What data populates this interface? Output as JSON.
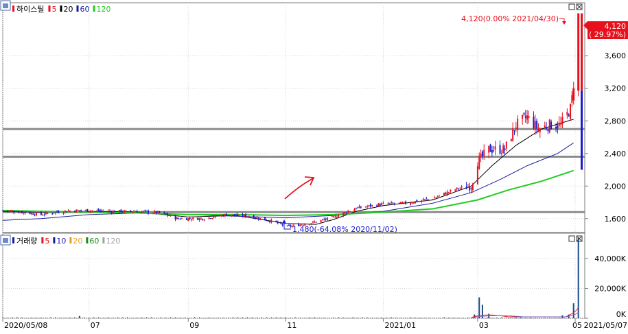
{
  "price_panel": {
    "corner_icon": "toggle-icon",
    "stock_name": "하이스틸",
    "ma_legend": [
      {
        "label": "5",
        "color": "#e8101c"
      },
      {
        "label": "20",
        "color": "#000000"
      },
      {
        "label": "60",
        "color": "#1a1aa0"
      },
      {
        "label": "120",
        "color": "#22cc22"
      }
    ],
    "high_annotation": "4,120(0.00% 2021/04/30)",
    "low_annotation": "1,480(-64.08% 2020/11/02)",
    "current_price": "4,120",
    "current_change": "( 29.97%)"
  },
  "volume_panel": {
    "corner_icon": "toggle-icon",
    "title": "거래량",
    "ma_legend": [
      {
        "label": "5",
        "color": "#e8101c"
      },
      {
        "label": "10",
        "color": "#1a1aa0"
      },
      {
        "label": "20",
        "color": "#e8a020"
      },
      {
        "label": "60",
        "color": "#1a8a1a"
      },
      {
        "label": "120",
        "color": "#a0a0a0"
      }
    ]
  },
  "colors": {
    "up": "#e8101c",
    "down": "#1a1ad0",
    "ma5": "#e8101c",
    "ma20": "#000000",
    "ma60": "#1a1aa0",
    "ma120": "#22cc22",
    "grid": "#d8d8d8",
    "support": "#8c8c8c"
  },
  "chart_data": [
    {
      "type": "candlestick",
      "title": "하이스틸",
      "x_ticks": [
        "2020/05/08",
        "07",
        "09",
        "11",
        "2021/01",
        "03",
        "05",
        "2021/05/07"
      ],
      "y_ticks": [
        "1,600",
        "2,000",
        "2,400",
        "2,800",
        "3,200",
        "3,600"
      ],
      "ylim": [
        1430,
        4250
      ],
      "grid": true,
      "x_range": [
        "2020/05/08",
        "2021/05/07"
      ],
      "horizontal_lines": [
        2700,
        2360,
        1680
      ],
      "annotated_points": [
        {
          "date": "2021/04/30",
          "value": 4120,
          "label": "4,120(0.00% 2021/04/30)"
        },
        {
          "date": "2020/11/02",
          "value": 1480,
          "label": "1,480(-64.08% 2020/11/02)"
        }
      ],
      "last_value": 4120,
      "last_change_pct": 29.97,
      "series": [
        {
          "name": "5",
          "kind": "close_approx",
          "points": [
            [
              "2020/05/08",
              1700
            ],
            [
              "2020/05/20",
              1680
            ],
            [
              "2020/06/01",
              1650
            ],
            [
              "2020/06/10",
              1680
            ],
            [
              "2020/06/20",
              1700
            ],
            [
              "2020/07/01",
              1700
            ],
            [
              "2020/07/15",
              1690
            ],
            [
              "2020/08/01",
              1690
            ],
            [
              "2020/08/15",
              1670
            ],
            [
              "2020/08/25",
              1600
            ],
            [
              "2020/09/10",
              1600
            ],
            [
              "2020/09/25",
              1650
            ],
            [
              "2020/10/10",
              1630
            ],
            [
              "2020/10/25",
              1560
            ],
            [
              "2020/11/02",
              1500
            ],
            [
              "2020/11/20",
              1560
            ],
            [
              "2020/12/01",
              1620
            ],
            [
              "2020/12/15",
              1730
            ],
            [
              "2021/01/01",
              1780
            ],
            [
              "2021/01/15",
              1790
            ],
            [
              "2021/02/01",
              1850
            ],
            [
              "2021/02/15",
              1960
            ],
            [
              "2021/02/25",
              2000
            ],
            [
              "2021/03/01",
              2300
            ],
            [
              "2021/03/08",
              2450
            ],
            [
              "2021/03/18",
              2450
            ],
            [
              "2021/03/25",
              2750
            ],
            [
              "2021/04/01",
              2850
            ],
            [
              "2021/04/08",
              2700
            ],
            [
              "2021/04/15",
              2750
            ],
            [
              "2021/04/22",
              2750
            ],
            [
              "2021/04/28",
              2950
            ],
            [
              "2021/04/30",
              3200
            ],
            [
              "2021/05/03",
              4120
            ]
          ]
        },
        {
          "name": "20",
          "kind": "ma",
          "points": [
            [
              "2020/05/08",
              1690
            ],
            [
              "2020/06/01",
              1680
            ],
            [
              "2020/07/01",
              1690
            ],
            [
              "2020/08/01",
              1680
            ],
            [
              "2020/09/01",
              1620
            ],
            [
              "2020/10/01",
              1640
            ],
            [
              "2020/11/01",
              1540
            ],
            [
              "2020/11/20",
              1530
            ],
            [
              "2020/12/01",
              1590
            ],
            [
              "2020/12/15",
              1690
            ],
            [
              "2021/01/01",
              1760
            ],
            [
              "2021/02/01",
              1830
            ],
            [
              "2021/02/25",
              2000
            ],
            [
              "2021/03/10",
              2250
            ],
            [
              "2021/03/25",
              2500
            ],
            [
              "2021/04/10",
              2700
            ],
            [
              "2021/04/30",
              2820
            ]
          ]
        },
        {
          "name": "60",
          "kind": "ma",
          "points": [
            [
              "2020/05/08",
              1580
            ],
            [
              "2020/06/01",
              1600
            ],
            [
              "2020/07/01",
              1650
            ],
            [
              "2020/08/01",
              1670
            ],
            [
              "2020/09/01",
              1650
            ],
            [
              "2020/10/01",
              1630
            ],
            [
              "2020/11/01",
              1610
            ],
            [
              "2020/12/01",
              1640
            ],
            [
              "2021/01/01",
              1690
            ],
            [
              "2021/02/01",
              1790
            ],
            [
              "2021/02/25",
              1920
            ],
            [
              "2021/03/15",
              2080
            ],
            [
              "2021/04/01",
              2250
            ],
            [
              "2021/04/20",
              2400
            ],
            [
              "2021/04/30",
              2530
            ]
          ]
        },
        {
          "name": "120",
          "kind": "ma",
          "points": [
            [
              "2020/05/08",
              1700
            ],
            [
              "2020/06/01",
              1690
            ],
            [
              "2020/07/01",
              1680
            ],
            [
              "2020/08/01",
              1670
            ],
            [
              "2020/09/01",
              1650
            ],
            [
              "2020/10/01",
              1650
            ],
            [
              "2020/11/01",
              1640
            ],
            [
              "2020/12/01",
              1650
            ],
            [
              "2021/01/01",
              1680
            ],
            [
              "2021/02/01",
              1720
            ],
            [
              "2021/03/01",
              1830
            ],
            [
              "2021/03/20",
              1950
            ],
            [
              "2021/04/10",
              2060
            ],
            [
              "2021/04/30",
              2190
            ]
          ]
        }
      ]
    },
    {
      "type": "bar",
      "title": "거래량",
      "y_ticks": [
        "0K",
        "20,000K",
        "40,000K"
      ],
      "ylim": [
        0,
        57000
      ],
      "grid": true,
      "bars": [
        [
          "2020/06/25",
          1500
        ],
        [
          "2021/02/27",
          2500
        ],
        [
          "2021/03/02",
          14000
        ],
        [
          "2021/03/04",
          9000
        ],
        [
          "2021/03/08",
          3000
        ],
        [
          "2021/04/23",
          2000
        ],
        [
          "2021/04/27",
          2500
        ],
        [
          "2021/04/30",
          10000
        ],
        [
          "2021/05/03",
          54000
        ]
      ]
    }
  ]
}
